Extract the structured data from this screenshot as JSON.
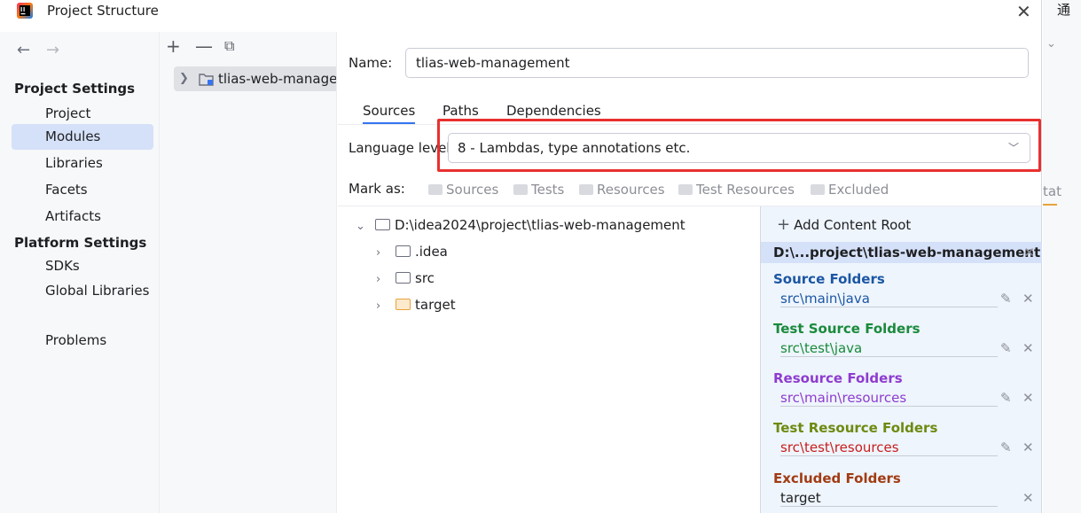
{
  "window": {
    "title": "Project Structure"
  },
  "nav": {
    "project_settings_label": "Project Settings",
    "project_items": [
      "Project",
      "Modules",
      "Libraries",
      "Facets",
      "Artifacts"
    ],
    "platform_settings_label": "Platform Settings",
    "platform_items": [
      "SDKs",
      "Global Libraries"
    ],
    "problems_label": "Problems",
    "selected": "Modules"
  },
  "modules": {
    "items": [
      "tlias-web-management"
    ]
  },
  "content": {
    "name_label": "Name:",
    "name_value": "tlias-web-management",
    "tabs": [
      "Sources",
      "Paths",
      "Dependencies"
    ],
    "active_tab": "Sources",
    "language_level_label": "Language level:",
    "language_level_value": "8 - Lambdas, type annotations etc.",
    "mark_as_label": "Mark as:",
    "mark_as_options": [
      "Sources",
      "Tests",
      "Resources",
      "Test Resources",
      "Excluded"
    ]
  },
  "tree": {
    "root": "D:\\idea2024\\project\\tlias-web-management",
    "children": [
      ".idea",
      "src",
      "target"
    ]
  },
  "roots": {
    "add_label": "Add Content Root",
    "path": "D:\\...project\\tlias-web-management",
    "sections": [
      {
        "title": "Source Folders",
        "value": "src\\main\\java",
        "color": "#1c56a4"
      },
      {
        "title": "Test Source Folders",
        "value": "src\\test\\java",
        "color": "#1a8a3c"
      },
      {
        "title": "Resource Folders",
        "value": "src\\main\\resources",
        "color": "#8e3ccf"
      },
      {
        "title": "Test Resource Folders",
        "value": "src\\test\\resources",
        "color": "#6d8a10"
      },
      {
        "title": "Excluded Folders",
        "value": "target",
        "color": "#a13b13"
      }
    ],
    "test_resource_value_color": "#c91d1d",
    "excluded_value_color": "#1e1f22"
  },
  "background": {
    "glyph": "通",
    "tab_fragment": "tat"
  },
  "colors": {
    "accent": "#3574f0",
    "highlight_box": "#e8302f",
    "selection": "#d5e1f8"
  }
}
